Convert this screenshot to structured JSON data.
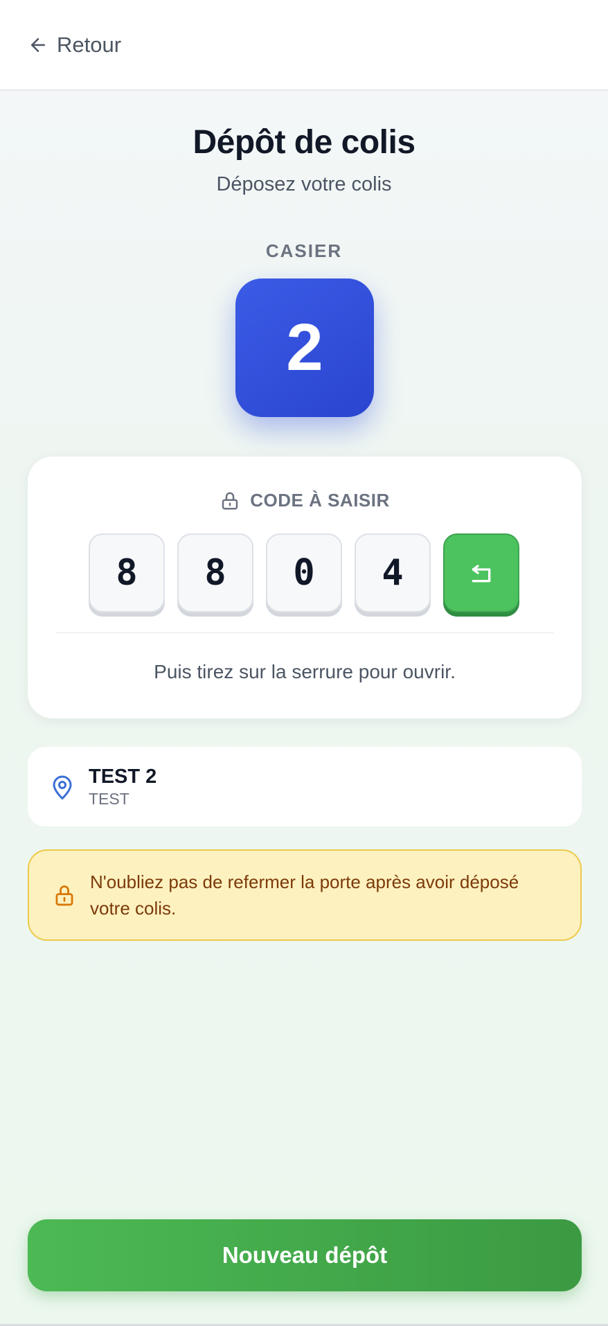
{
  "header": {
    "back_label": "Retour"
  },
  "page": {
    "title": "Dépôt de colis",
    "subtitle": "Déposez votre colis"
  },
  "casier": {
    "label": "CASIER",
    "number": "2"
  },
  "code": {
    "label": "CODE À SAISIR",
    "digits": [
      "8",
      "8",
      "0",
      "4"
    ],
    "hint": "Puis tirez sur la serrure pour ouvrir."
  },
  "location": {
    "name": "TEST 2",
    "sub": "TEST"
  },
  "warning": {
    "text": "N'oubliez pas de refermer la porte après avoir déposé votre colis."
  },
  "actions": {
    "new_deposit": "Nouveau dépôt"
  },
  "colors": {
    "accent_blue": "#2f4fdc",
    "accent_green": "#45b050",
    "warning_bg": "#fdf1bf",
    "warning_text": "#7c3a0a"
  },
  "icons": [
    "arrow-left-icon",
    "lock-icon",
    "enter-icon",
    "map-pin-icon",
    "lock-warning-icon"
  ]
}
